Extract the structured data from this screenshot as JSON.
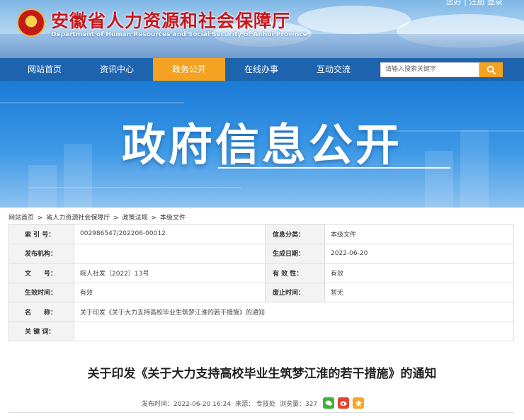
{
  "header": {
    "title": "安徽省人力资源和社会保障厅",
    "subtitle": "Department of Human Resources and Social Security of Anhui Province",
    "toplinks": "您好 | 注册 登录"
  },
  "nav": {
    "items": [
      "网站首页",
      "资讯中心",
      "政务公开",
      "在线办事",
      "互动交流"
    ],
    "active_index": 2,
    "search_placeholder": "请输入搜索关键字"
  },
  "banner": {
    "title": "政府信息公开"
  },
  "breadcrumb": [
    "网站首页",
    ">",
    "省人力资源社会保障厅",
    ">",
    "政策法规",
    ">",
    "本级文件"
  ],
  "meta": {
    "index_label": "索 引 号：",
    "index_value": "002986547/202206-00012",
    "category_label": "信息分类：",
    "category_value": "本级文件",
    "publisher_label": "发布机构：",
    "publisher_value": "",
    "date_label": "生成日期：",
    "date_value": "2022-06-20",
    "docno_label": "文　　号：",
    "docno_value": "皖人社发〔2022〕13号",
    "validity_label": "有 效 性：",
    "validity_value": "有效",
    "effective_label": "生效时间：",
    "effective_value": "有效",
    "expiry_label": "废止时间：",
    "expiry_value": "暂无",
    "name_label": "名　　称：",
    "name_value": "关于印发《关于大力支持高校毕业生筑梦江淮的若干措施》的通知",
    "keywords_label": "关 键 词：",
    "keywords_value": ""
  },
  "article": {
    "title": "关于印发《关于大力支持高校毕业生筑梦江淮的若干措施》的通知",
    "publish_time": "发布时间：2022-06-20 16:24",
    "source": "来源： 专技处",
    "views": "浏览量：327"
  },
  "colors": {
    "nav_bg": "#1d63ad",
    "nav_active": "#f3a321",
    "title_red": "#c8161d",
    "banner_blue": "#1a7bd6"
  }
}
